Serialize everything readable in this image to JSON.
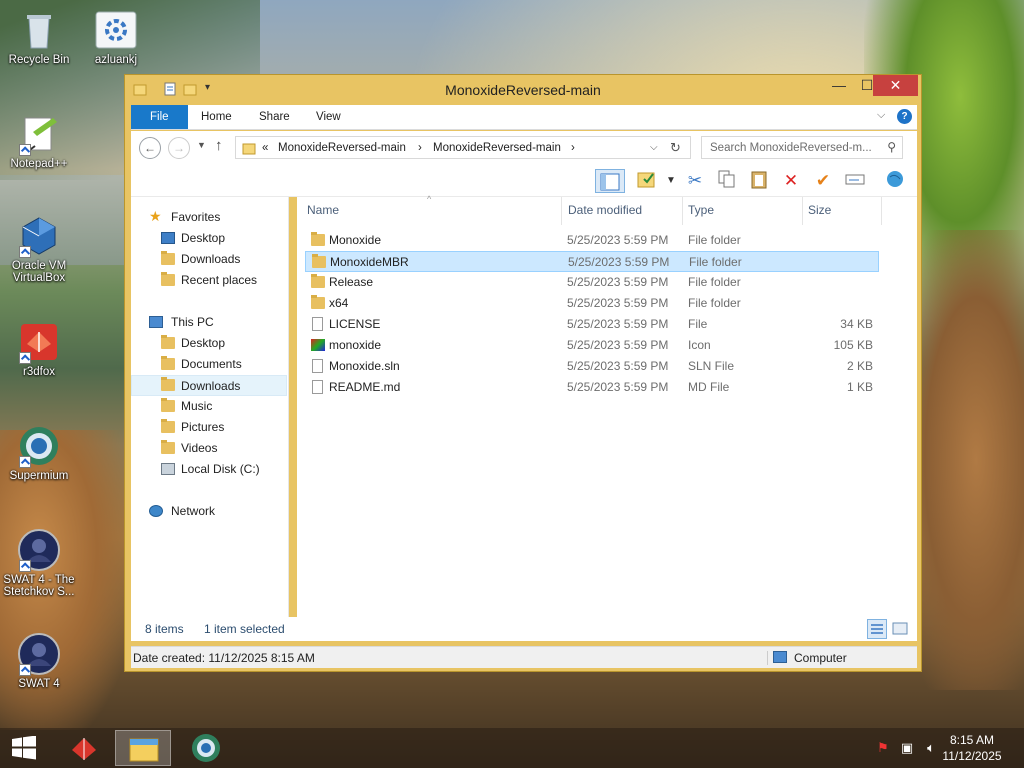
{
  "desktop": {
    "icons": [
      {
        "label": "Recycle Bin",
        "icon": "recycle-bin-icon"
      },
      {
        "label": "azluankj",
        "icon": "settings-app-icon"
      },
      {
        "label": "Notepad++",
        "icon": "notepadpp-icon"
      },
      {
        "label": "Oracle VM VirtualBox",
        "icon": "virtualbox-icon"
      },
      {
        "label": "r3dfox",
        "icon": "r3dfox-icon"
      },
      {
        "label": "Supermium",
        "icon": "supermium-icon"
      },
      {
        "label": "SWAT 4 - The Stetchkov S...",
        "icon": "swat4-icon"
      },
      {
        "label": "SWAT 4",
        "icon": "swat4-icon"
      }
    ]
  },
  "window": {
    "title": "MonoxideReversed-main",
    "controls": {
      "minimize": "—",
      "maximize": "☐",
      "close": "✕"
    },
    "ribbon_tabs": [
      "File",
      "Home",
      "Share",
      "View"
    ],
    "address": {
      "prefix": "«",
      "crumbs": [
        "MonoxideReversed-main",
        "MonoxideReversed-main"
      ],
      "separator": "›"
    },
    "search_placeholder": "Search MonoxideReversed-m...",
    "nav": {
      "favorites_label": "Favorites",
      "favorites": [
        "Desktop",
        "Downloads",
        "Recent places"
      ],
      "thispc_label": "This PC",
      "thispc": [
        "Desktop",
        "Documents",
        "Downloads",
        "Music",
        "Pictures",
        "Videos",
        "Local Disk (C:)"
      ],
      "network_label": "Network",
      "selected": "Downloads"
    },
    "columns": {
      "name": "Name",
      "date": "Date modified",
      "type": "Type",
      "size": "Size"
    },
    "files": [
      {
        "name": "Monoxide",
        "date": "5/25/2023 5:59 PM",
        "type": "File folder",
        "size": "",
        "kind": "folder"
      },
      {
        "name": "MonoxideMBR",
        "date": "5/25/2023 5:59 PM",
        "type": "File folder",
        "size": "",
        "kind": "folder",
        "selected": true
      },
      {
        "name": "Release",
        "date": "5/25/2023 5:59 PM",
        "type": "File folder",
        "size": "",
        "kind": "folder"
      },
      {
        "name": "x64",
        "date": "5/25/2023 5:59 PM",
        "type": "File folder",
        "size": "",
        "kind": "folder"
      },
      {
        "name": "LICENSE",
        "date": "5/25/2023 5:59 PM",
        "type": "File",
        "size": "34 KB",
        "kind": "doc"
      },
      {
        "name": "monoxide",
        "date": "5/25/2023 5:59 PM",
        "type": "Icon",
        "size": "105 KB",
        "kind": "icon"
      },
      {
        "name": "Monoxide.sln",
        "date": "5/25/2023 5:59 PM",
        "type": "SLN File",
        "size": "2 KB",
        "kind": "doc"
      },
      {
        "name": "README.md",
        "date": "5/25/2023 5:59 PM",
        "type": "MD File",
        "size": "1 KB",
        "kind": "doc"
      }
    ],
    "status": {
      "items": "8 items",
      "selected": "1 item selected"
    },
    "details": {
      "created": "Date created: 11/12/2025 8:15 AM",
      "location": "Computer"
    }
  },
  "taskbar": {
    "clock_time": "8:15 AM",
    "clock_date": "11/12/2025",
    "apps": [
      "r3dfox-icon",
      "file-explorer-icon",
      "supermium-icon"
    ]
  }
}
